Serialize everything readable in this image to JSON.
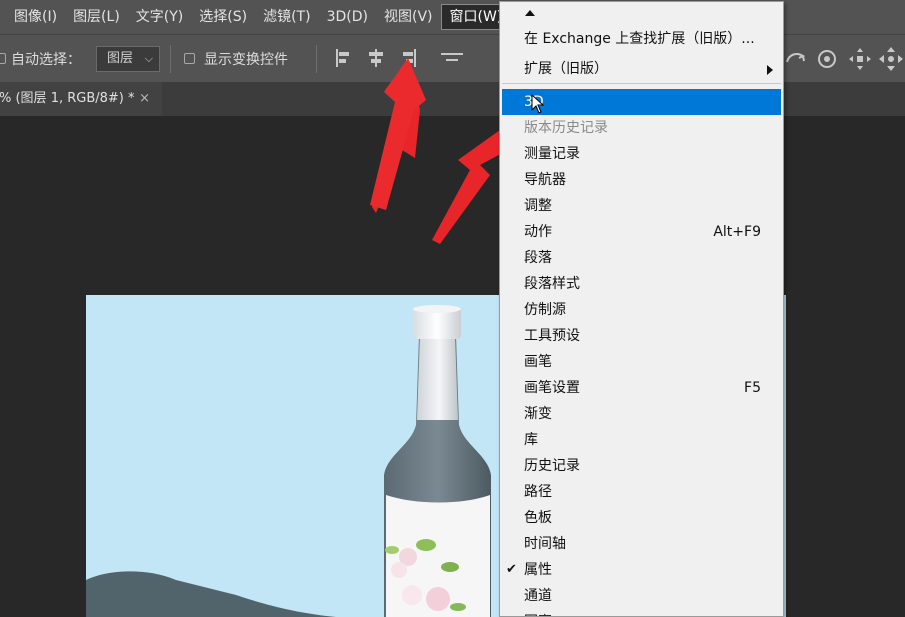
{
  "menubar": {
    "items": [
      "图像(I)",
      "图层(L)",
      "文字(Y)",
      "选择(S)",
      "滤镜(T)",
      "3D(D)",
      "视图(V)",
      "窗口(W)"
    ],
    "active": "窗口(W)"
  },
  "options": {
    "auto_select_label": "自动选择：",
    "auto_select_value": "图层",
    "show_transform_label": "显示变换控件"
  },
  "document": {
    "tab_title": "% (图层 1, RGB/8#) *",
    "close_glyph": "×"
  },
  "window_menu": {
    "items": [
      {
        "label": "在 Exchange 上查找扩展（旧版）...",
        "shortcut": "",
        "submenu": false,
        "checked": false,
        "disabled": false,
        "highlighted": false
      },
      {
        "label": "扩展（旧版）",
        "shortcut": "",
        "submenu": true,
        "checked": false,
        "disabled": false,
        "highlighted": false
      },
      {
        "label": "3D",
        "shortcut": "",
        "submenu": false,
        "checked": false,
        "disabled": false,
        "highlighted": true
      },
      {
        "label": "版本历史记录",
        "shortcut": "",
        "submenu": false,
        "checked": false,
        "disabled": true,
        "highlighted": false
      },
      {
        "label": "测量记录",
        "shortcut": "",
        "submenu": false,
        "checked": false,
        "disabled": false,
        "highlighted": false
      },
      {
        "label": "导航器",
        "shortcut": "",
        "submenu": false,
        "checked": false,
        "disabled": false,
        "highlighted": false
      },
      {
        "label": "调整",
        "shortcut": "",
        "submenu": false,
        "checked": false,
        "disabled": false,
        "highlighted": false
      },
      {
        "label": "动作",
        "shortcut": "Alt+F9",
        "submenu": false,
        "checked": false,
        "disabled": false,
        "highlighted": false
      },
      {
        "label": "段落",
        "shortcut": "",
        "submenu": false,
        "checked": false,
        "disabled": false,
        "highlighted": false
      },
      {
        "label": "段落样式",
        "shortcut": "",
        "submenu": false,
        "checked": false,
        "disabled": false,
        "highlighted": false
      },
      {
        "label": "仿制源",
        "shortcut": "",
        "submenu": false,
        "checked": false,
        "disabled": false,
        "highlighted": false
      },
      {
        "label": "工具预设",
        "shortcut": "",
        "submenu": false,
        "checked": false,
        "disabled": false,
        "highlighted": false
      },
      {
        "label": "画笔",
        "shortcut": "",
        "submenu": false,
        "checked": false,
        "disabled": false,
        "highlighted": false
      },
      {
        "label": "画笔设置",
        "shortcut": "F5",
        "submenu": false,
        "checked": false,
        "disabled": false,
        "highlighted": false
      },
      {
        "label": "渐变",
        "shortcut": "",
        "submenu": false,
        "checked": false,
        "disabled": false,
        "highlighted": false
      },
      {
        "label": "库",
        "shortcut": "",
        "submenu": false,
        "checked": false,
        "disabled": false,
        "highlighted": false
      },
      {
        "label": "历史记录",
        "shortcut": "",
        "submenu": false,
        "checked": false,
        "disabled": false,
        "highlighted": false
      },
      {
        "label": "路径",
        "shortcut": "",
        "submenu": false,
        "checked": false,
        "disabled": false,
        "highlighted": false
      },
      {
        "label": "色板",
        "shortcut": "",
        "submenu": false,
        "checked": false,
        "disabled": false,
        "highlighted": false
      },
      {
        "label": "时间轴",
        "shortcut": "",
        "submenu": false,
        "checked": false,
        "disabled": false,
        "highlighted": false
      },
      {
        "label": "属性",
        "shortcut": "",
        "submenu": false,
        "checked": true,
        "disabled": false,
        "highlighted": false
      },
      {
        "label": "通道",
        "shortcut": "",
        "submenu": false,
        "checked": false,
        "disabled": false,
        "highlighted": false
      },
      {
        "label": "图案",
        "shortcut": "",
        "submenu": false,
        "checked": false,
        "disabled": false,
        "highlighted": false
      }
    ]
  },
  "colors": {
    "highlight": "#0078d7",
    "annotation_arrow": "#e8262a",
    "canvas_bg": "#c3e6f6"
  }
}
